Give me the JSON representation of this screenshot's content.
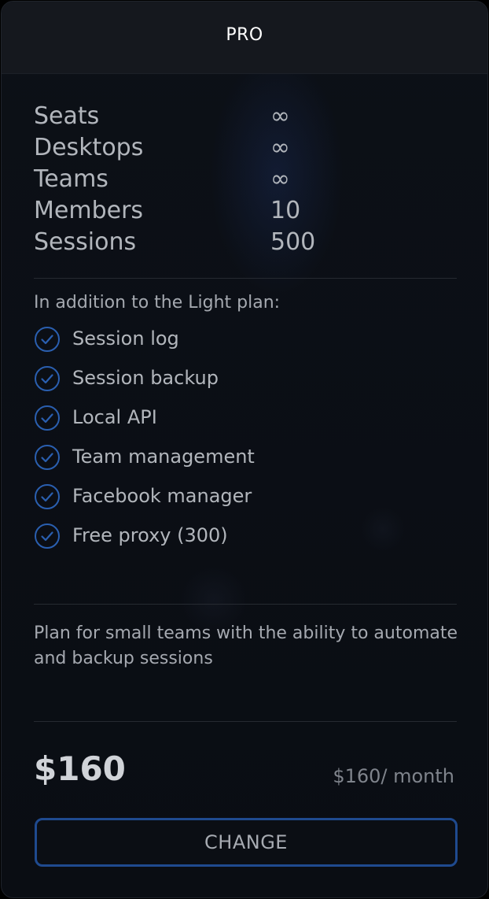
{
  "plan": {
    "title": "PRO"
  },
  "stats": [
    {
      "label": "Seats",
      "value": "∞"
    },
    {
      "label": "Desktops",
      "value": "∞"
    },
    {
      "label": "Teams",
      "value": "∞"
    },
    {
      "label": "Members",
      "value": "10"
    },
    {
      "label": "Sessions",
      "value": "500"
    }
  ],
  "features": {
    "intro": "In addition to the Light plan:",
    "items": [
      {
        "label": "Session log",
        "icon": "check-circle-icon"
      },
      {
        "label": "Session backup",
        "icon": "check-circle-icon"
      },
      {
        "label": "Local API",
        "icon": "check-circle-icon"
      },
      {
        "label": "Team management",
        "icon": "check-circle-icon"
      },
      {
        "label": "Facebook manager",
        "icon": "check-circle-icon"
      },
      {
        "label": "Free proxy (300)",
        "icon": "check-circle-icon"
      }
    ]
  },
  "description": "Plan for small teams with the ability to automate and backup sessions",
  "pricing": {
    "price": "$160",
    "period_price": "$160/ month"
  },
  "actions": {
    "change_label": "CHANGE"
  },
  "colors": {
    "accent": "#1f4a8f",
    "check_icon": "#2a5fb0",
    "background": "#0a0d13",
    "header": "#15181e"
  }
}
